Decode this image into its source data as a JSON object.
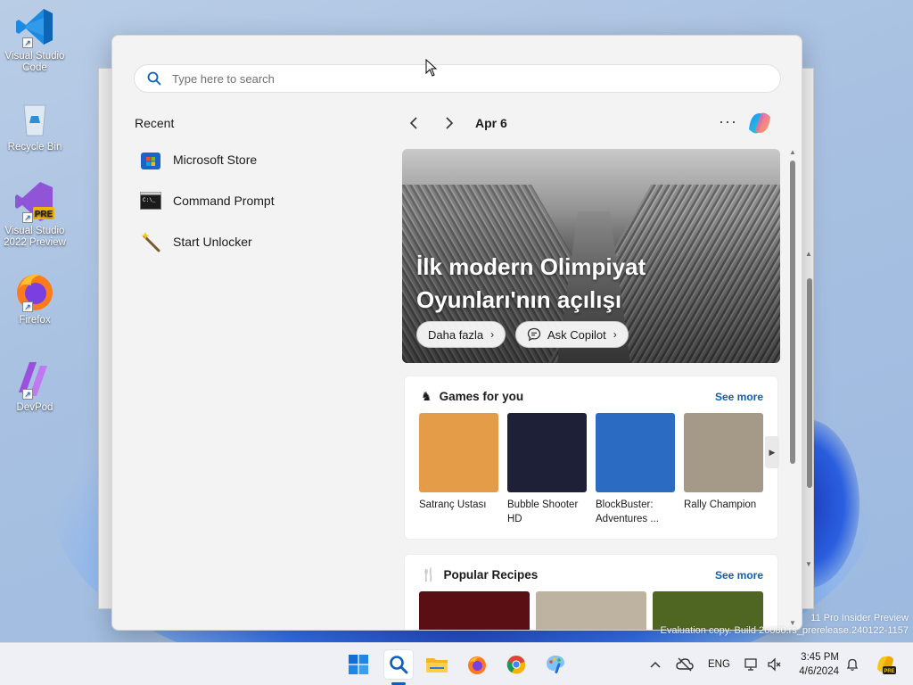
{
  "desktop": {
    "icons": [
      {
        "label": "Visual Studio Code",
        "icon": "vscode-icon"
      },
      {
        "label": "Recycle Bin",
        "icon": "recycle-bin-icon"
      },
      {
        "label": "Visual Studio 2022 Preview",
        "icon": "visual-studio-icon",
        "badge": "PRE"
      },
      {
        "label": "Firefox",
        "icon": "firefox-icon"
      },
      {
        "label": "DevPod",
        "icon": "devpod-icon"
      }
    ]
  },
  "search": {
    "placeholder": "Type here to search",
    "value": ""
  },
  "recent": {
    "title": "Recent",
    "items": [
      {
        "label": "Microsoft Store",
        "icon": "microsoft-store-icon"
      },
      {
        "label": "Command Prompt",
        "icon": "command-prompt-icon"
      },
      {
        "label": "Start Unlocker",
        "icon": "magic-wand-icon"
      }
    ]
  },
  "nav": {
    "date": "Apr 6",
    "more": "···"
  },
  "hero": {
    "title": "İlk modern Olimpiyat Oyunları'nın açılışı",
    "more_label": "Daha fazla",
    "copilot_label": "Ask Copilot"
  },
  "games": {
    "title": "Games for you",
    "see_more": "See more",
    "items": [
      {
        "name": "Satranç Ustası",
        "color": "#E59C49"
      },
      {
        "name": "Bubble Shooter HD",
        "color": "#1E2038"
      },
      {
        "name": "BlockBuster: Adventures ...",
        "color": "#2B6BC2"
      },
      {
        "name": "Rally Champion",
        "color": "#A59A88"
      }
    ]
  },
  "recipes": {
    "title": "Popular Recipes",
    "see_more": "See more",
    "colors": [
      "#5A0F14",
      "#BEB2A1",
      "#4F6623"
    ]
  },
  "watermark": {
    "line1": "11 Pro Insider Preview",
    "line2": "Evaluation copy. Build 26080.rs_prerelease.240122-1157"
  },
  "taskbar": {
    "apps": [
      "windows-start-icon",
      "search-icon",
      "file-explorer-icon",
      "firefox-icon",
      "chrome-icon",
      "paint-icon"
    ],
    "language": "ENG",
    "time": "3:45 PM",
    "date": "4/6/2024"
  },
  "accent_color": "#0F5FB8"
}
